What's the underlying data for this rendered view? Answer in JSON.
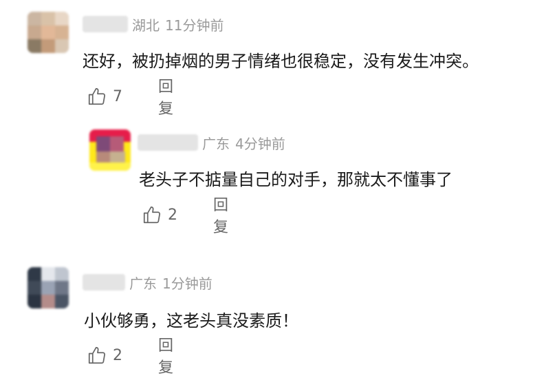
{
  "comments": [
    {
      "location": "湖北",
      "time": "11分钟前",
      "text": "还好，被扔掉烟的男子情绪也很稳定，没有发生冲突。",
      "likes": "7",
      "reply_label": "回复",
      "like_icon": "thumbs-up-icon"
    },
    {
      "location": "广东",
      "time": "4分钟前",
      "text": "老头子不掂量自己的对手，那就太不懂事了",
      "likes": "2",
      "reply_label": "回复",
      "like_icon": "thumbs-up-icon"
    },
    {
      "location": "广东",
      "time": "1分钟前",
      "text": "小伙够勇，这老头真没素质！",
      "likes": "2",
      "reply_label": "回复",
      "like_icon": "thumbs-up-icon"
    }
  ],
  "colors": {
    "meta_text": "#9a9a9a",
    "body_text": "#1a1a1a",
    "action_text": "#666666"
  }
}
